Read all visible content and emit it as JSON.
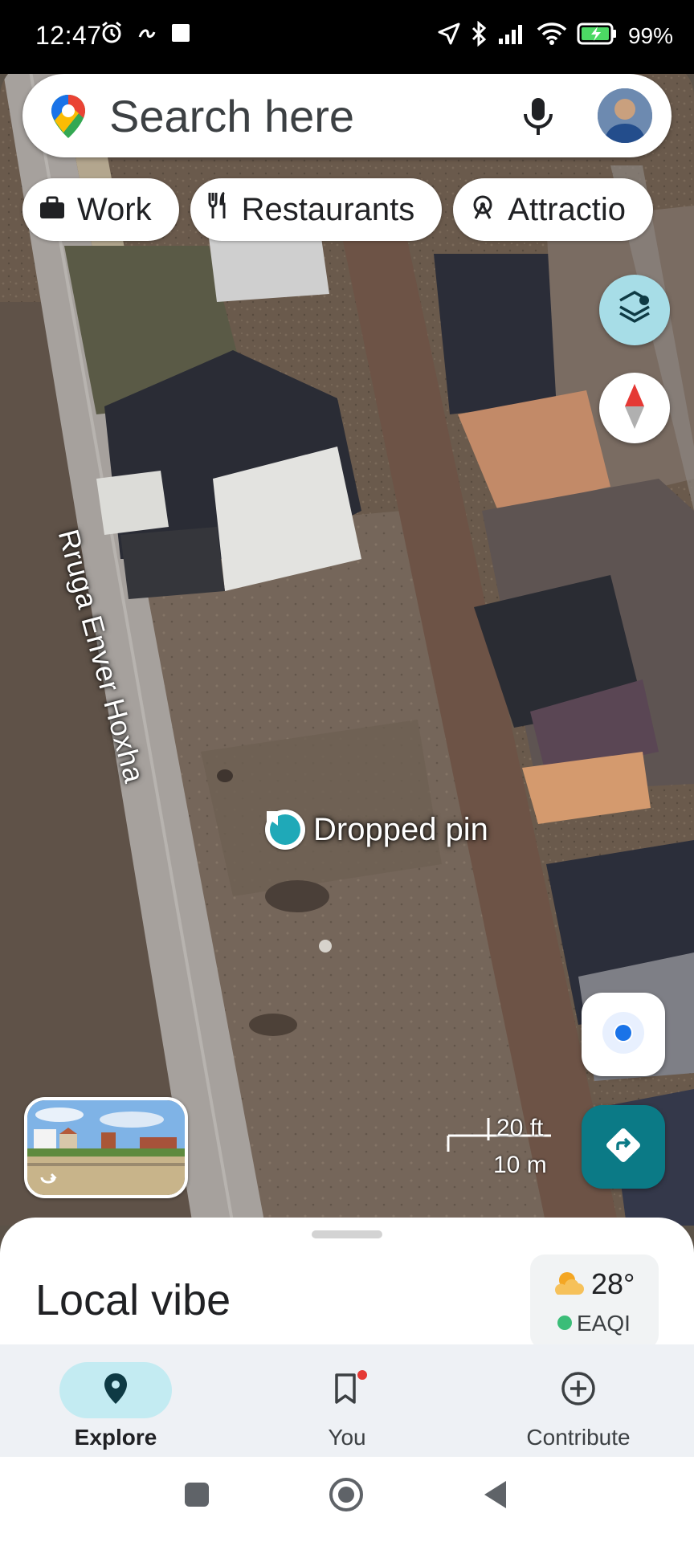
{
  "status_bar": {
    "time": "12:47",
    "battery": "99%",
    "icons": [
      "alarm-icon",
      "link-icon",
      "square-notification-icon",
      "location-arrow-icon",
      "bluetooth-icon",
      "signal-icon",
      "wifi-icon",
      "battery-charging-icon"
    ]
  },
  "search": {
    "placeholder": "Search here",
    "icons": [
      "maps-logo-icon",
      "mic-icon",
      "avatar"
    ]
  },
  "chips": [
    {
      "label": "Work",
      "icon": "briefcase-icon"
    },
    {
      "label": "Restaurants",
      "icon": "fork-knife-icon"
    },
    {
      "label": "Attractio",
      "icon": "attractions-icon"
    }
  ],
  "map": {
    "street_label": "Rruga Enver Hoxha",
    "pin_label": "Dropped pin",
    "scale_ft": "20 ft",
    "scale_m": "10 m",
    "accent": "#0b7a86",
    "pin_color": "#1fa9b8"
  },
  "sheet": {
    "title": "Local vibe",
    "temperature": "28°",
    "aqi_label": "EAQI",
    "aqi_color": "#3bbd78"
  },
  "bottom_nav": [
    {
      "label": "Explore",
      "icon": "location-pin-icon",
      "active": true
    },
    {
      "label": "You",
      "icon": "bookmark-icon",
      "active": false,
      "badge": true
    },
    {
      "label": "Contribute",
      "icon": "add-circle-icon",
      "active": false
    }
  ],
  "system_nav": [
    "recents-button",
    "home-button",
    "back-button"
  ]
}
